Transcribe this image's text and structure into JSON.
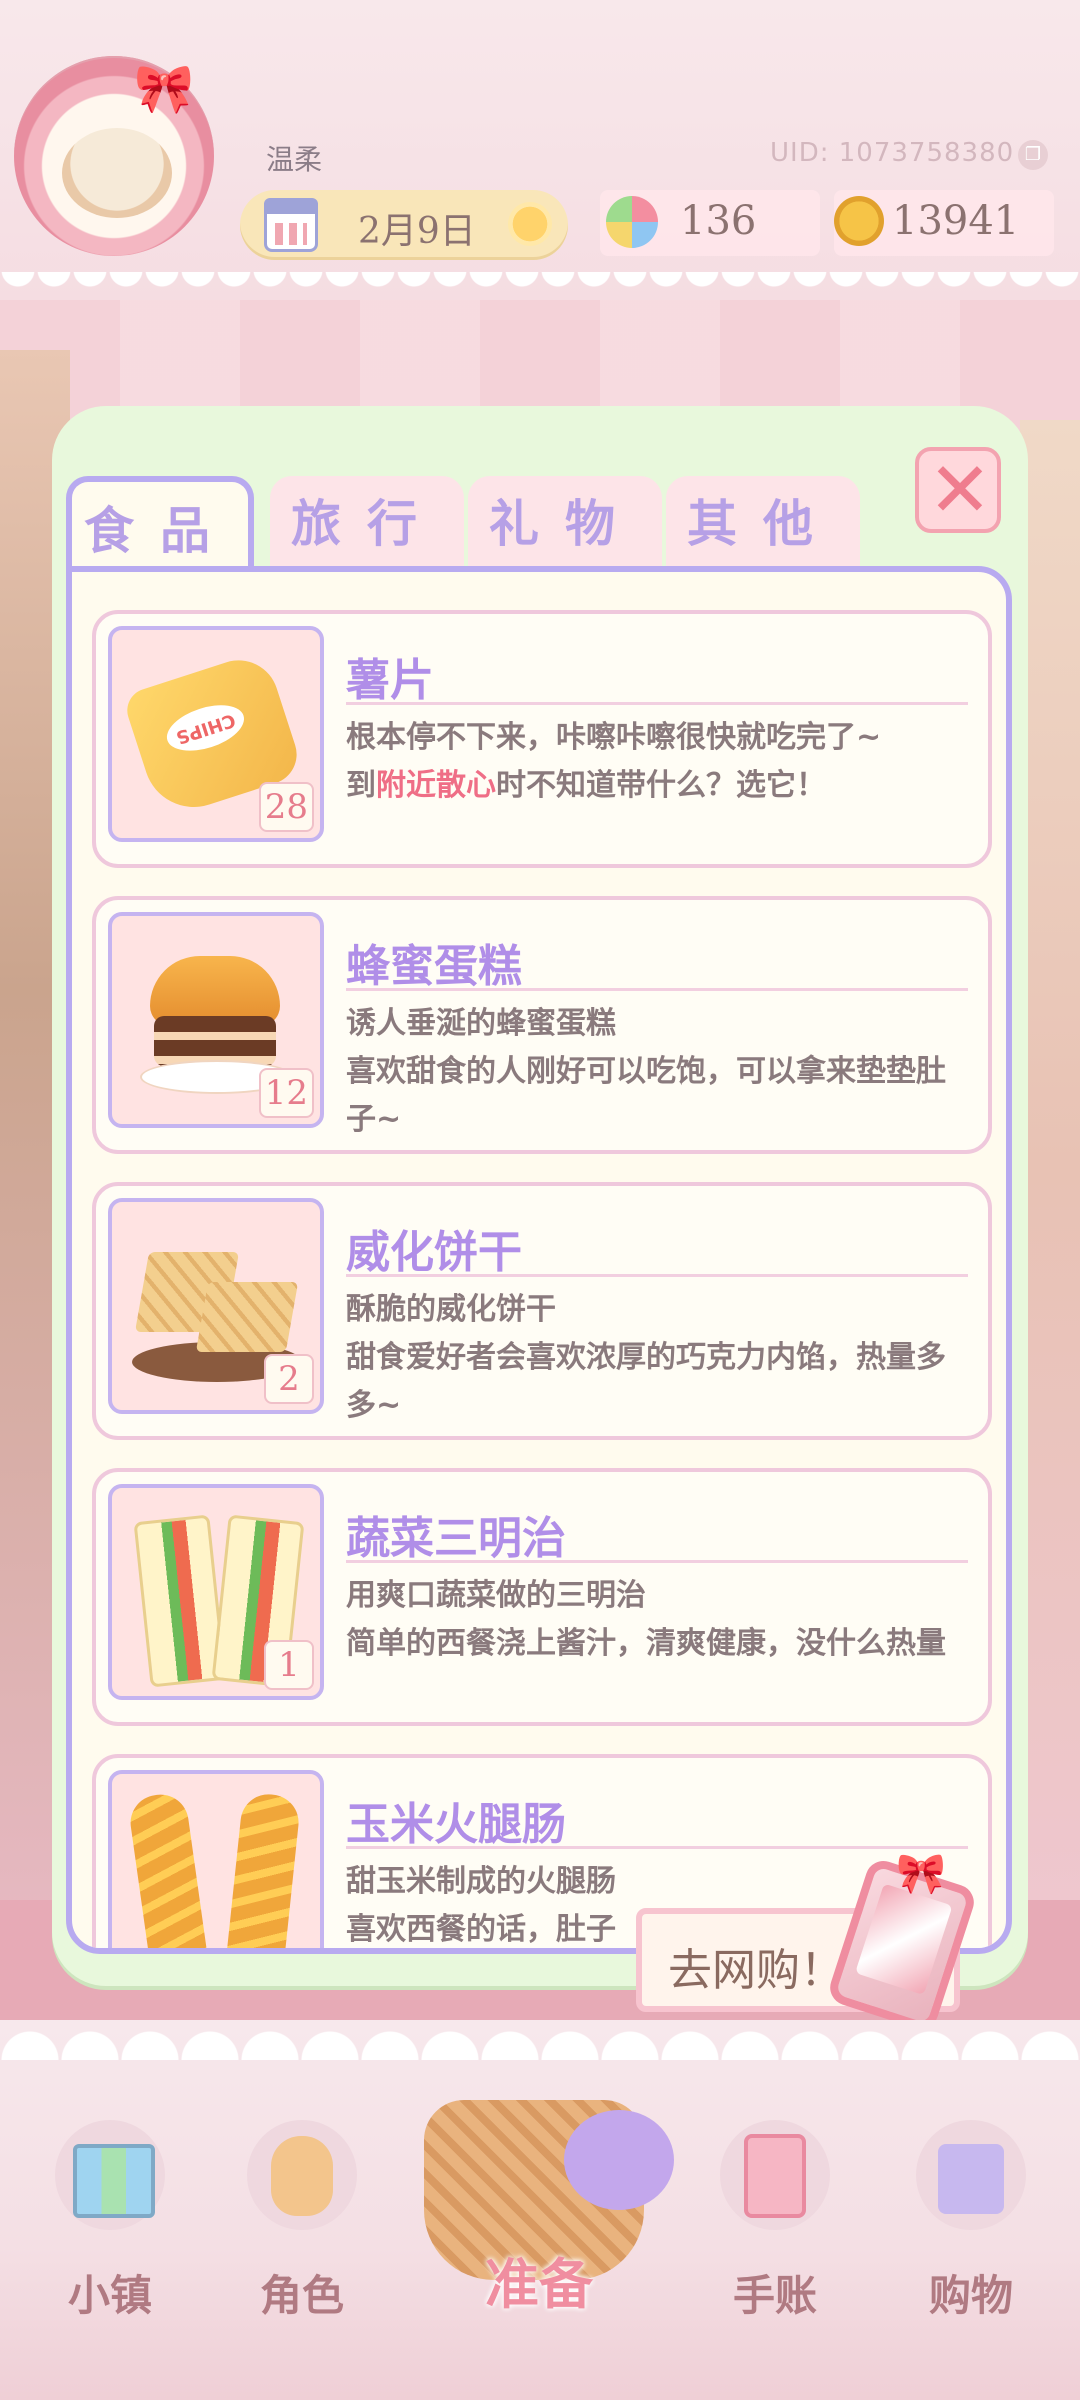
{
  "header": {
    "username": "温柔",
    "uid": "UID: 1073758380",
    "date": "2月9日",
    "flowers": "136",
    "coins": "13941"
  },
  "tabs": [
    {
      "label": "食品",
      "active": true
    },
    {
      "label": "旅行",
      "active": false
    },
    {
      "label": "礼物",
      "active": false
    },
    {
      "label": "其他",
      "active": false
    }
  ],
  "items": [
    {
      "name": "薯片",
      "qty": "28",
      "desc_line1": "根本停不下来，咔嚓咔嚓很快就吃完了~",
      "desc_prefix": "到",
      "desc_highlight": "附近散心",
      "desc_suffix": "时不知道带什么？选它！",
      "icon": "chips-icon"
    },
    {
      "name": "蜂蜜蛋糕",
      "qty": "12",
      "desc_line1": "诱人垂涎的蜂蜜蛋糕",
      "desc_line2": "喜欢甜食的人刚好可以吃饱，可以拿来垫垫肚子~",
      "icon": "honey-cake-icon"
    },
    {
      "name": "威化饼干",
      "qty": "2",
      "desc_line1": "酥脆的威化饼干",
      "desc_line2": "甜食爱好者会喜欢浓厚的巧克力内馅，热量多多~",
      "icon": "wafer-icon"
    },
    {
      "name": "蔬菜三明治",
      "qty": "1",
      "desc_line1": "用爽口蔬菜做的三明治",
      "desc_line2": "简单的西餐浇上酱汁，清爽健康，没什么热量",
      "icon": "sandwich-icon"
    },
    {
      "name": "玉米火腿肠",
      "desc_line1": "甜玉米制成的火腿肠",
      "desc_line2": "喜欢西餐的话，肚子",
      "icon": "corn-sausage-icon"
    }
  ],
  "shop_button": "去网购！",
  "nav": {
    "town": "小镇",
    "role": "角色",
    "prepare": "准备",
    "journal": "手账",
    "shopping": "购物"
  },
  "colors": {
    "accent_purple": "#b08ee8",
    "highlight_red": "#ef6e86",
    "panel_green": "#e8f8dc",
    "tab_border": "#b8aaf0"
  }
}
